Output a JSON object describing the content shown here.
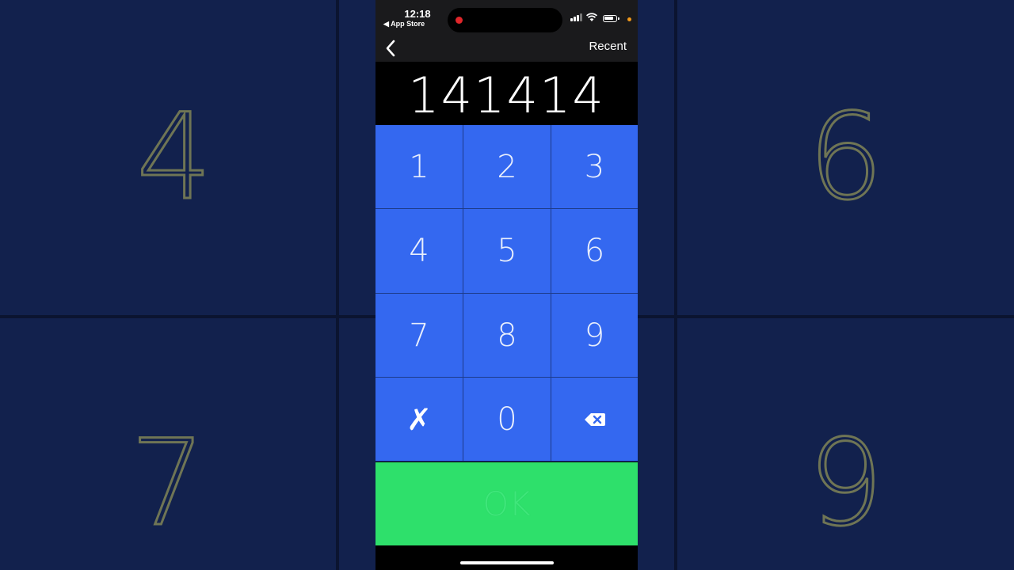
{
  "background": {
    "tiles": [
      {
        "digit": "4"
      },
      {
        "digit": "6"
      },
      {
        "digit": "7"
      },
      {
        "digit": "9"
      }
    ]
  },
  "statusbar": {
    "time": "12:18",
    "back_app": "◀ App Store"
  },
  "navbar": {
    "recent_label": "Recent"
  },
  "display": {
    "value": "141414"
  },
  "keypad": {
    "keys": [
      "1",
      "2",
      "3",
      "4",
      "5",
      "6",
      "7",
      "8",
      "9",
      "✗",
      "0"
    ],
    "clear_icon": "clear-icon",
    "delete_icon": "backspace-icon"
  },
  "ok_label": "OK",
  "colors": {
    "keypad_blue": "#3468f0",
    "ok_green": "#2ee06b",
    "background_navy": "#12214d"
  }
}
